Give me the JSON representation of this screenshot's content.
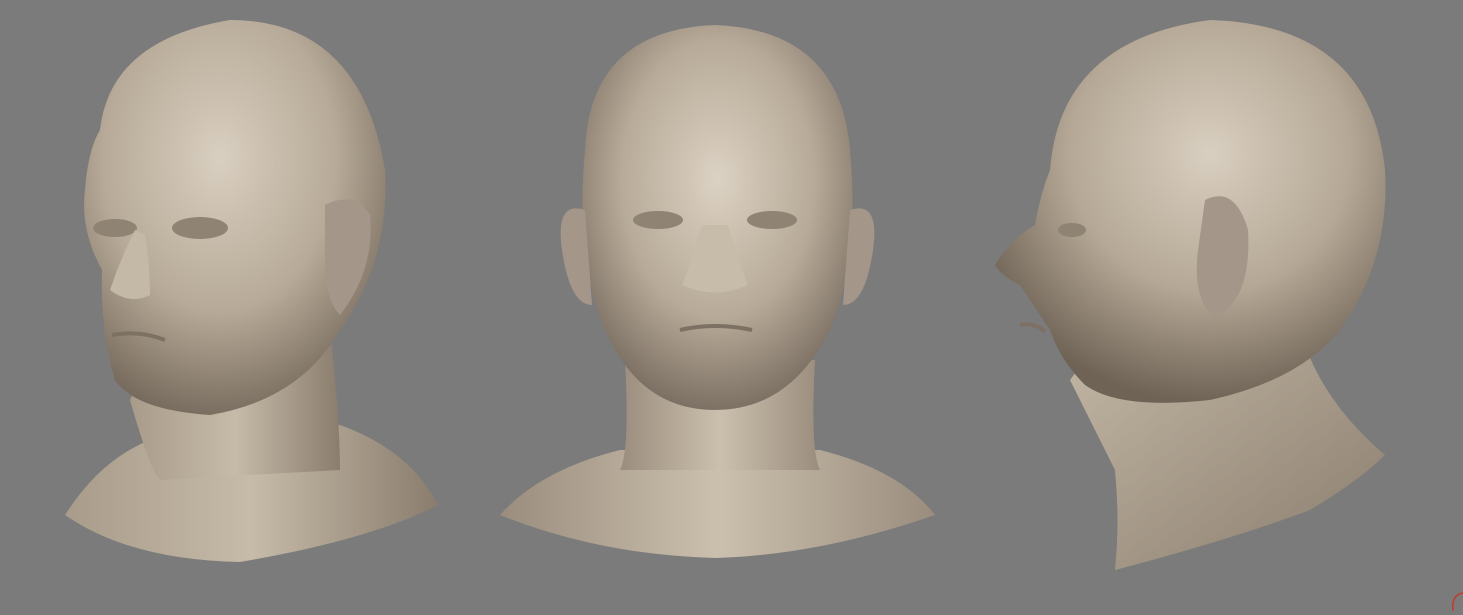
{
  "scene": {
    "background_color": "#7b7b7b",
    "material_color": "#b7aa98",
    "material_shadow": "#6f6356",
    "material_highlight": "#d9cfc0",
    "views": [
      {
        "id": "three-quarter-left",
        "icon": "sculpted-head-three-quarter"
      },
      {
        "id": "front",
        "icon": "sculpted-head-front"
      },
      {
        "id": "profile-right",
        "icon": "sculpted-head-profile"
      }
    ],
    "corner_mark_color": "#c0392b"
  }
}
